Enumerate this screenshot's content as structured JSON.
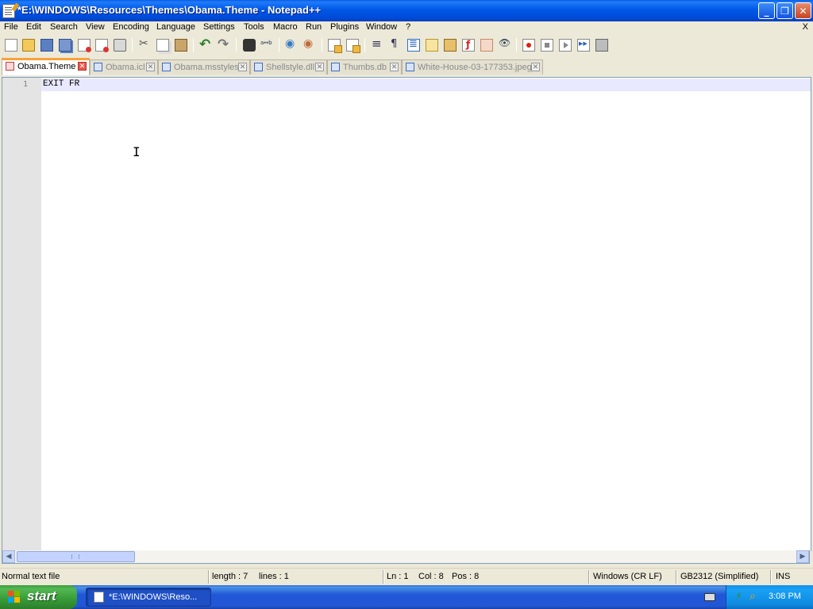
{
  "window": {
    "title": "*E:\\WINDOWS\\Resources\\Themes\\Obama.Theme - Notepad++",
    "controls": {
      "minimize": "_",
      "maximize": "❐",
      "close": "✕"
    }
  },
  "menu": {
    "items": [
      "File",
      "Edit",
      "Search",
      "View",
      "Encoding",
      "Language",
      "Settings",
      "Tools",
      "Macro",
      "Run",
      "Plugins",
      "Window",
      "?"
    ],
    "close_doc": "X"
  },
  "toolbar": {
    "icons": [
      "new-file-icon",
      "open-file-icon",
      "save-icon",
      "save-all-icon",
      "close-icon",
      "close-all-icon",
      "print-icon",
      "cut-icon",
      "copy-icon",
      "paste-icon",
      "undo-icon",
      "redo-icon",
      "find-icon",
      "replace-icon",
      "zoom-in-icon",
      "zoom-out-icon",
      "sync-vertical-icon",
      "sync-horizontal-icon",
      "word-wrap-icon",
      "show-all-chars-icon",
      "indent-guide-icon",
      "user-language-icon",
      "document-map-icon",
      "function-list-icon",
      "folder-workspace-icon",
      "monitoring-icon",
      "record-macro-icon",
      "stop-macro-icon",
      "play-macro-icon",
      "run-macro-multiple-icon",
      "save-macro-icon"
    ]
  },
  "tabs": [
    {
      "label": "Obama.Theme",
      "active": true
    },
    {
      "label": "Obama.icl",
      "active": false
    },
    {
      "label": "Obama.msstyles",
      "active": false
    },
    {
      "label": "Shellstyle.dll",
      "active": false
    },
    {
      "label": "Thumbs.db",
      "active": false
    },
    {
      "label": "White-House-03-177353.jpeg",
      "active": false
    }
  ],
  "editor": {
    "lines": [
      {
        "number": "1",
        "text": "EXIT FR"
      }
    ]
  },
  "statusbar": {
    "file_type": "Normal text file",
    "length": "length : 7",
    "lines": "lines : 1",
    "ln": "Ln : 1",
    "col": "Col : 8",
    "pos": "Pos : 8",
    "eol": "Windows (CR LF)",
    "encoding": "GB2312 (Simplified)",
    "mode": "INS"
  },
  "taskbar": {
    "start_label": "start",
    "window_button": "*E:\\WINDOWS\\Reso...",
    "clock": "3:08 PM"
  },
  "colors": {
    "titlebar": "#0058E6",
    "active_tab_accent": "#F9A13A",
    "current_line": "#E8E8FF",
    "start_green": "#379A37",
    "taskbar_blue": "#2157D7"
  }
}
